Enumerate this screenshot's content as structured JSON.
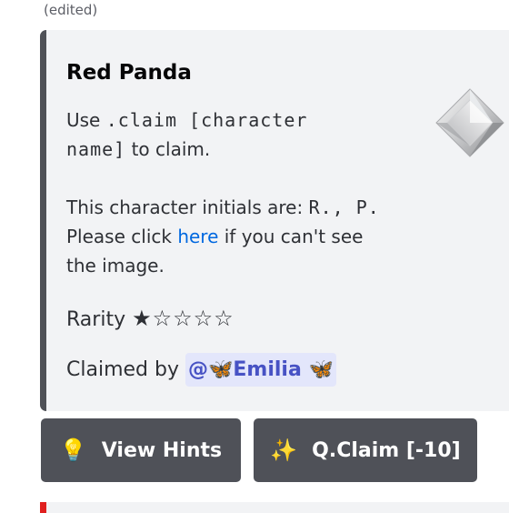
{
  "message": {
    "edited_label": "(edited)"
  },
  "embed": {
    "title": "Red Panda",
    "description": {
      "use_label": "Use",
      "command_line1": ".claim [character",
      "command_line2": "name]",
      "claim_suffix": "to claim.",
      "initials_label": "This character initials are:",
      "initials_value": "R., P.",
      "click_prefix": "Please click",
      "link_text": "here",
      "click_suffix_line1": "if you can't see",
      "click_suffix_line2": "the image."
    },
    "rarity_label": "Rarity",
    "rarity_stars": "★☆☆☆☆",
    "rarity_value": 1,
    "rarity_max": 5,
    "claimed_label": "Claimed by",
    "claimed_user": "@🦋Emilia 🦋",
    "thumbnail_icon": "diamond-gem-icon",
    "accent_color": "#4f5157"
  },
  "buttons": [
    {
      "icon": "💡",
      "icon_name": "lightbulb-icon",
      "label": "View Hints"
    },
    {
      "icon": "✨",
      "icon_name": "sparkles-icon",
      "label": "Q.Claim [-10]"
    }
  ],
  "colors": {
    "link": "#0068e0",
    "mention_bg": "#e3e6fb",
    "mention_text": "#4752c4",
    "button_bg": "#4f5158",
    "next_embed_accent": "#e0201f"
  }
}
